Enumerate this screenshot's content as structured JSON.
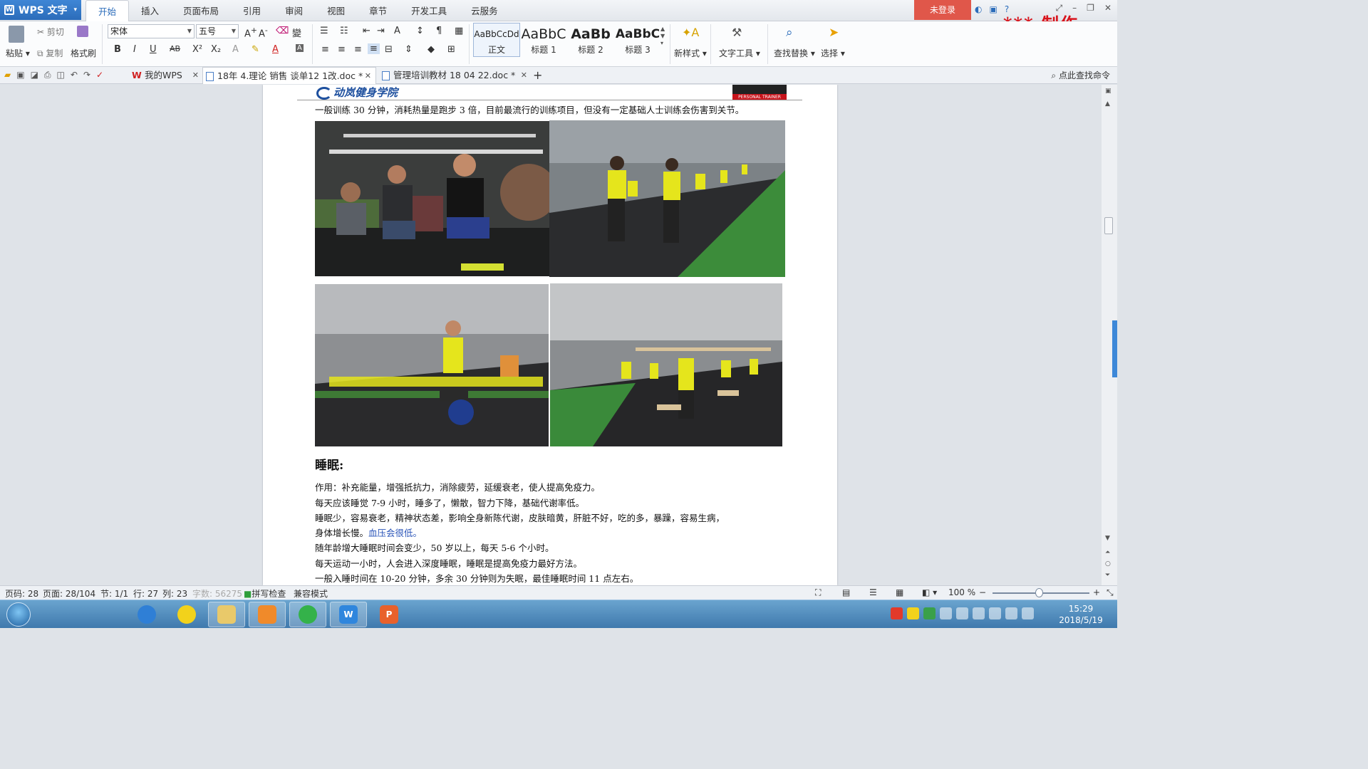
{
  "app": {
    "title": "WPS 文字",
    "login": "未登录",
    "watermark": "*** 制作"
  },
  "menu": [
    "开始",
    "插入",
    "页面布局",
    "引用",
    "审阅",
    "视图",
    "章节",
    "开发工具",
    "云服务"
  ],
  "ribbon": {
    "paste": "粘贴",
    "cut": "剪切",
    "copy": "复制",
    "format_painter": "格式刷",
    "font_name": "宋体",
    "font_size": "五号",
    "styles": [
      {
        "sample": "AaBbCcDd",
        "name": "正文"
      },
      {
        "sample": "AaBbC",
        "name": "标题 1"
      },
      {
        "sample": "AaBb",
        "name": "标题 2"
      },
      {
        "sample": "AaBbC",
        "name": "标题 3"
      }
    ],
    "new_style": "新样式",
    "text_tools": "文字工具",
    "find_replace": "查找替换",
    "select": "选择"
  },
  "tabs": {
    "my_wps": "我的WPS",
    "doc1": "18年 4.理论 销售 谈单12 1改.doc *",
    "doc2": "管理培训教材 18 04 22.doc *",
    "search_cmd": "点此查找命令"
  },
  "document": {
    "header_logo": "动岚健身学院",
    "badge": "PERSONAL TRAINER",
    "intro": "一般训练 30 分钟，消耗热量是跑步 3 倍，目前最流行的训练项目，但没有一定基础人士训练会伤害到关节。",
    "sleep_heading": "睡眠:",
    "lines": [
      "作用：补充能量，增强抵抗力，消除疲劳，延缓衰老，使人提高免疫力。",
      "每天应该睡觉 7-9 小时，睡多了，懒散，智力下降，基础代谢率低。",
      "睡眠少，容易衰老，精神状态差，影响全身新陈代谢，皮肤暗黄，肝脏不好，吃的多，暴躁，容易生病，",
      "身体增长慢。",
      "随年龄增大睡眠时间会变少，50 岁以上，每天 5-6 个小时。",
      "每天运动一小时，人会进入深度睡眠，睡眠是提高免疫力最好方法。",
      "一般入睡时间在 10-20 分钟，多余 30 分钟则为失眠，最佳睡眠时间 11 点左右。"
    ],
    "link_text": "血压会很低。"
  },
  "status": {
    "page_code": "页码: 28",
    "page": "页面: 28/104",
    "section": "节: 1/1",
    "row": "行: 27",
    "col": "列: 23",
    "words": "字数: 56275",
    "spell": "拼写检查",
    "compat": "兼容模式",
    "zoom": "100 %"
  },
  "clock": {
    "time": "15:29",
    "date": "2018/5/19"
  },
  "colors": {
    "accent": "#2b6cba",
    "login": "#e0574a",
    "watermark": "#d8141c",
    "link": "#2a54b8"
  }
}
